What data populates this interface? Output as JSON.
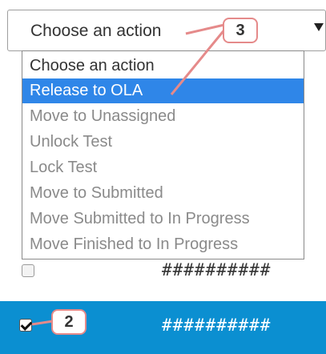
{
  "select": {
    "value": "Choose an action",
    "caret_icon": "triangle-down-icon"
  },
  "dropdown": {
    "options": [
      {
        "label": "Choose an action"
      },
      {
        "label": "Release to OLA",
        "highlighted": true
      },
      {
        "label": "Move to Unassigned"
      },
      {
        "label": "Unlock Test"
      },
      {
        "label": "Lock Test"
      },
      {
        "label": "Move to Submitted"
      },
      {
        "label": "Move Submitted to In Progress"
      },
      {
        "label": "Move Finished to In Progress"
      }
    ]
  },
  "rows": [
    {
      "value": "##########",
      "checked": false
    },
    {
      "value": "##########",
      "checked": true
    }
  ],
  "callouts": [
    {
      "number": "3"
    },
    {
      "number": "2"
    }
  ],
  "colors": {
    "highlight": "#2f86e8",
    "selected_row": "#0b8fd1",
    "annotation": "#e58a8a"
  }
}
